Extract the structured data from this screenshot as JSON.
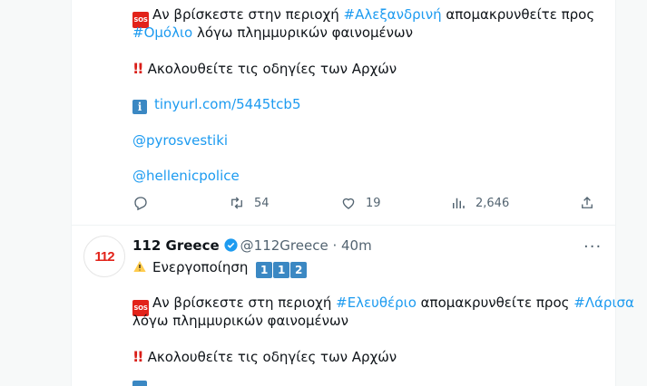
{
  "tweet1": {
    "line1_pre": "Αν βρίσκεστε στην περιοχή ",
    "line1_tag": "#Αλεξανδρινή",
    "line1_post": " απομακρυνθείτε προς",
    "line2_tag": "#Ομόλιο",
    "line2_post": " λόγω πλημμυρικών φαινομένων",
    "follow_text": "Ακολουθείτε τις οδηγίες των Αρχών",
    "link": "tinyurl.com/5445tcb5",
    "mention1": "@pyrosvestiki",
    "mention2": "@hellenicpolice",
    "actions": {
      "replies": "",
      "retweets": "54",
      "likes": "19",
      "views": "2,646"
    }
  },
  "tweet2": {
    "avatar_text": "112",
    "display_name": "112 Greece",
    "handle_time": "@112Greece · 40m",
    "activation_text": "Ενεργοποίηση",
    "digits": [
      "1",
      "1",
      "2"
    ],
    "line1_pre": "Αν βρίσκεστε στη περιοχή ",
    "line1_tag": "#Ελευθέριο",
    "line1_mid": " απομακρυνθείτε προς ",
    "line1_tag2": "#Λάρισα",
    "line2": "λόγω πλημμυρικών φαινομένων",
    "follow_text": "Ακολουθείτε τις οδηγίες των Αρχών"
  },
  "badges": {
    "sos": "SOS",
    "info": "i",
    "excl": "!!"
  },
  "colors": {
    "link": "#1d9bf0",
    "muted": "#536471",
    "sos": "#e2231a",
    "keycap": "#3b88c3"
  }
}
